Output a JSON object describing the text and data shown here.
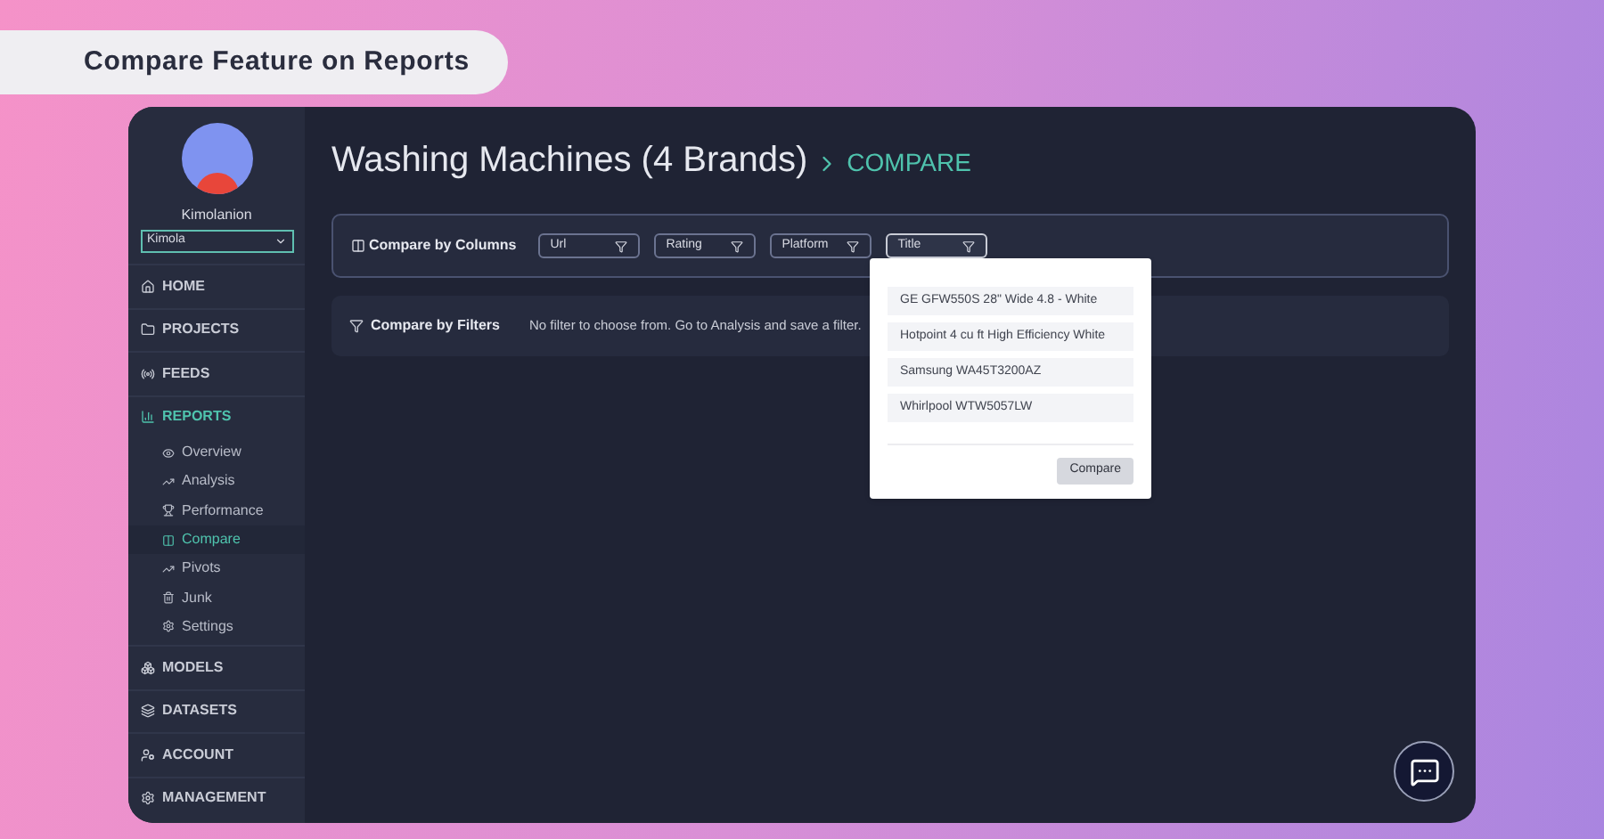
{
  "banner": {
    "title": "Compare Feature on Reports"
  },
  "user": {
    "name": "Kimolanion",
    "workspace": "Kimola"
  },
  "nav": [
    {
      "label": "HOME",
      "selected": false
    },
    {
      "label": "PROJECTS",
      "selected": false
    },
    {
      "label": "FEEDS",
      "selected": false
    },
    {
      "label": "REPORTS",
      "selected": true,
      "expanded": true,
      "children": [
        {
          "label": "Overview",
          "selected": false
        },
        {
          "label": "Analysis",
          "selected": false
        },
        {
          "label": "Performance",
          "selected": false
        },
        {
          "label": "Compare",
          "selected": true
        },
        {
          "label": "Pivots",
          "selected": false
        },
        {
          "label": "Junk",
          "selected": false
        },
        {
          "label": "Settings",
          "selected": false
        }
      ]
    },
    {
      "label": "MODELS",
      "selected": false
    },
    {
      "label": "DATASETS",
      "selected": false
    },
    {
      "label": "ACCOUNT",
      "selected": false
    },
    {
      "label": "MANAGEMENT",
      "selected": false
    }
  ],
  "page": {
    "title": "Washing Machines (4 Brands)",
    "breadcrumb": "COMPARE"
  },
  "columns_panel": {
    "label": "Compare by Columns",
    "filters": [
      {
        "label": "Url",
        "open": false
      },
      {
        "label": "Rating",
        "open": false
      },
      {
        "label": "Platform",
        "open": false
      },
      {
        "label": "Title",
        "open": true
      }
    ]
  },
  "filters_panel": {
    "label": "Compare by Filters",
    "message": "No filter to choose from. Go to Analysis and save a filter."
  },
  "dropdown": {
    "options": [
      "GE GFW550S 28\" Wide 4.8 - White",
      "Hotpoint 4 cu ft High Efficiency White",
      "Samsung WA45T3200AZ",
      "Whirlpool WTW5057LW"
    ],
    "button": "Compare"
  }
}
